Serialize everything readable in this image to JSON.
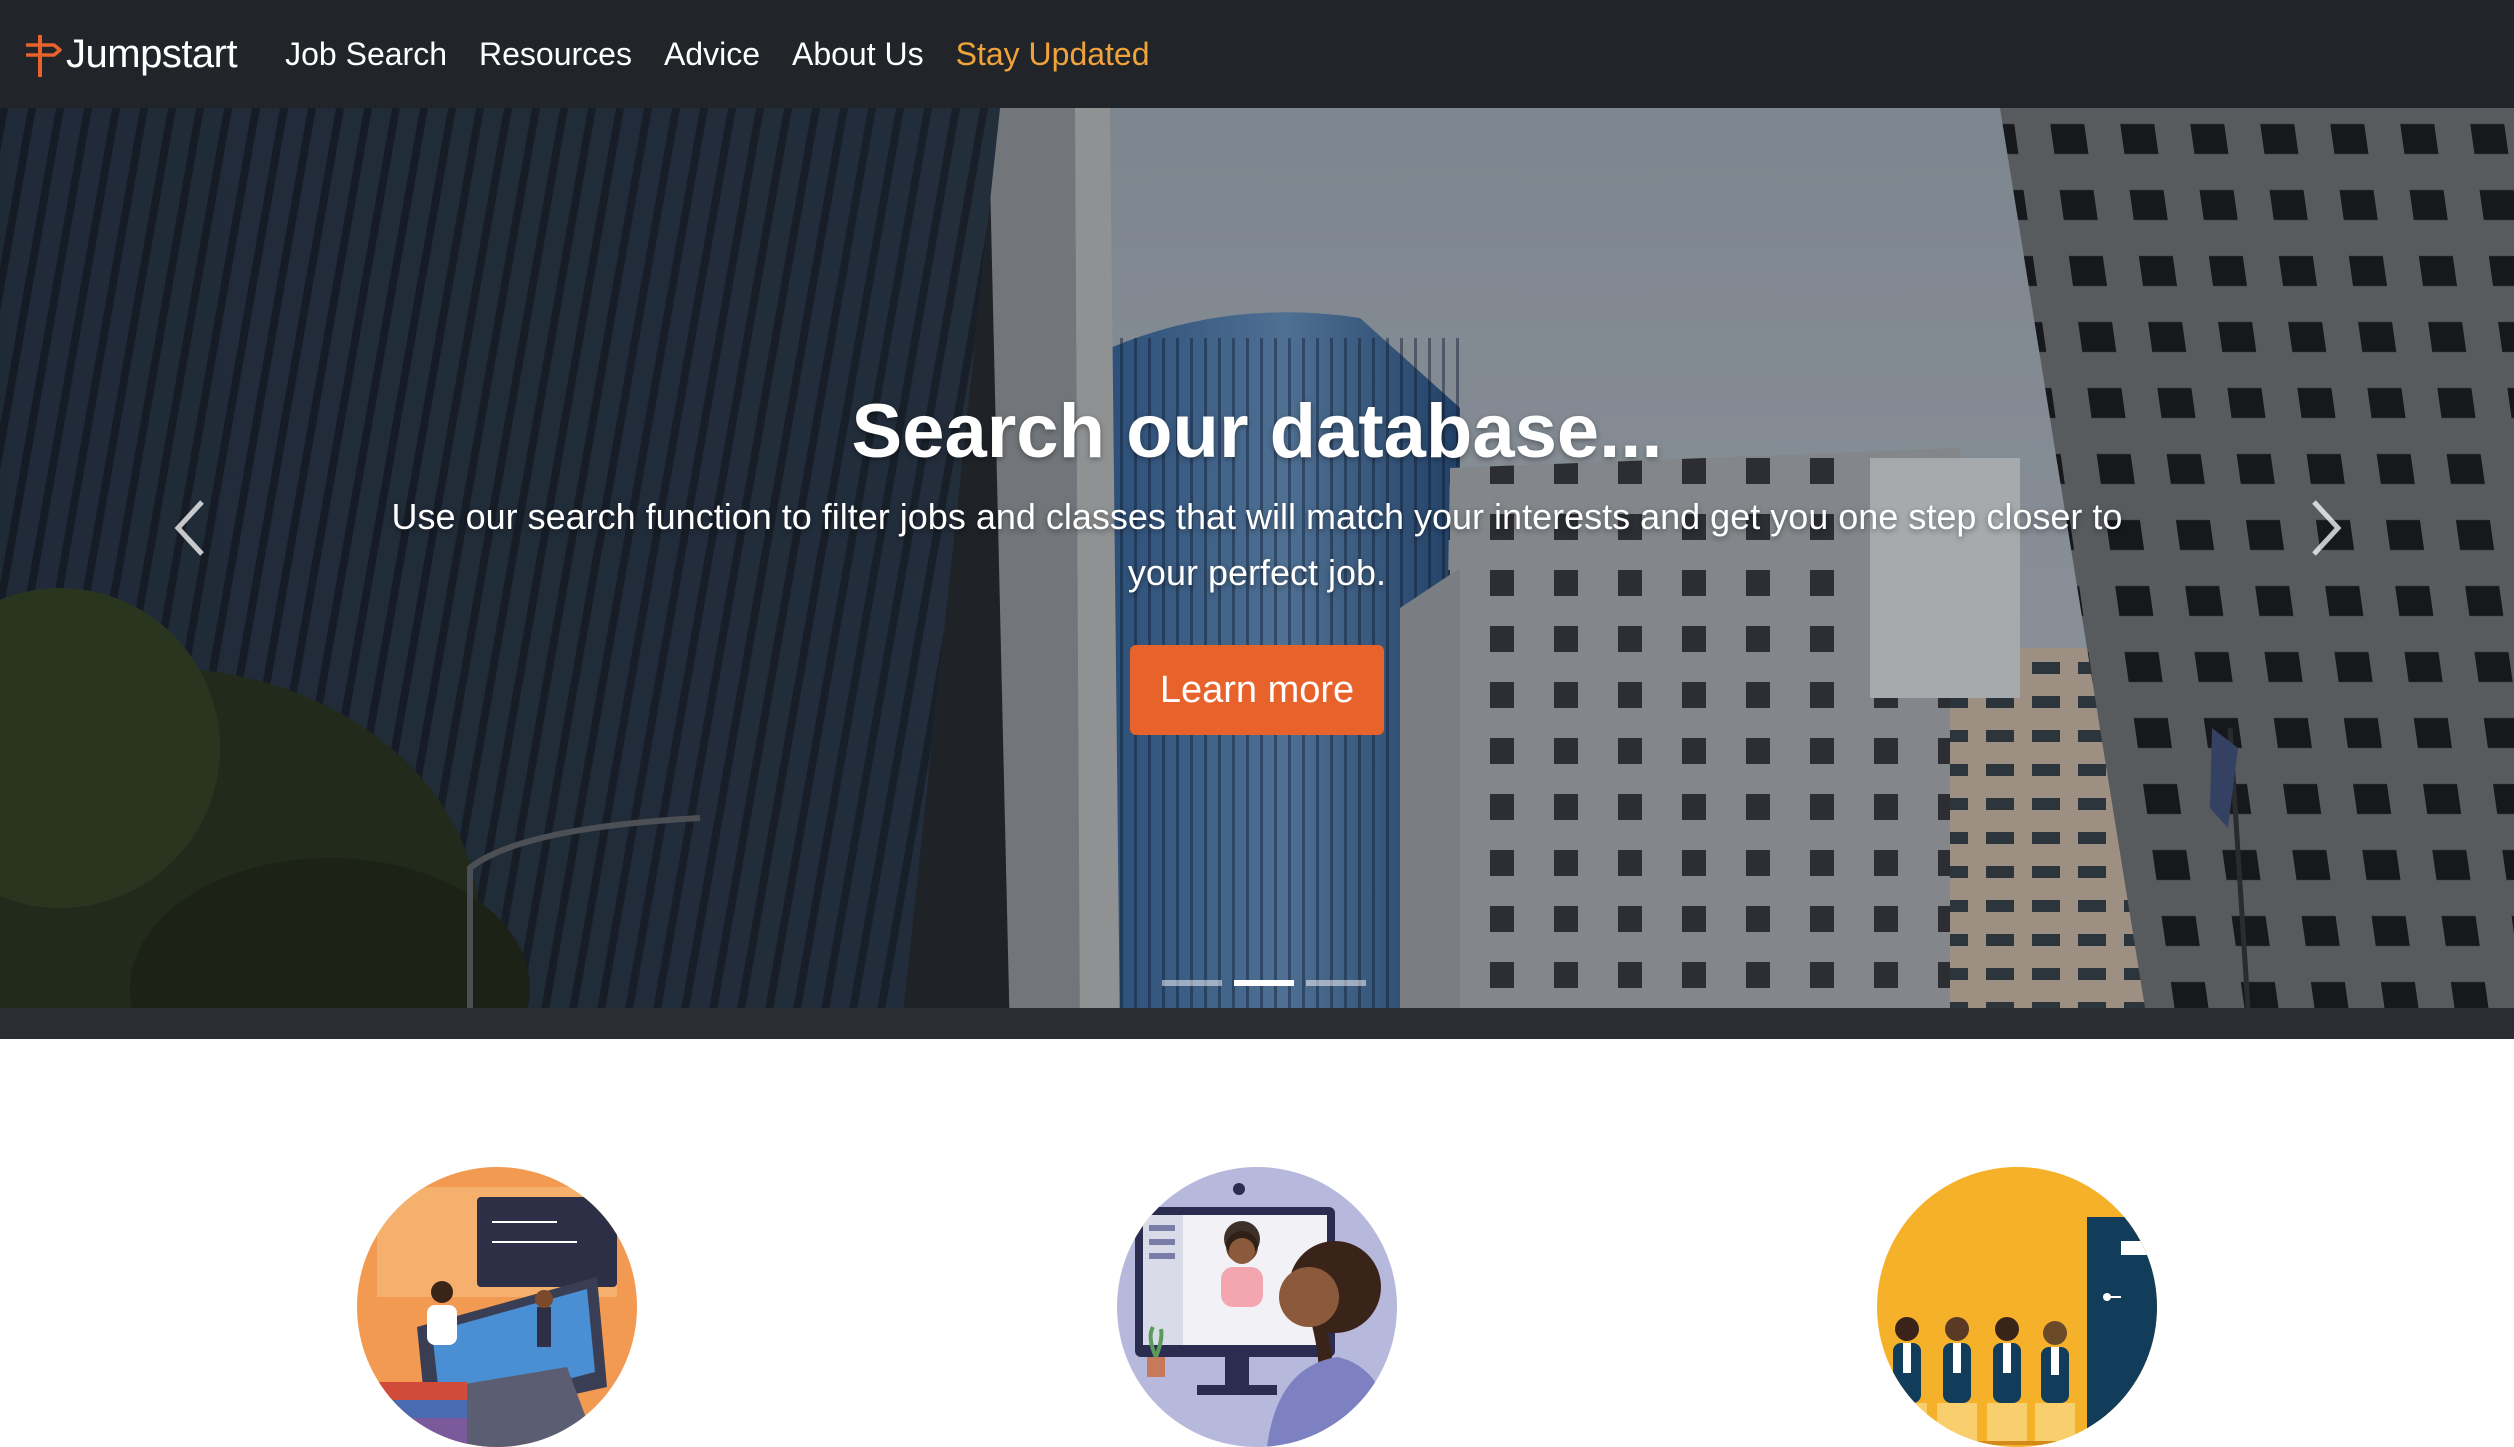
{
  "brand": {
    "name": "Jumpstart"
  },
  "nav": {
    "items": [
      {
        "label": "Job Search"
      },
      {
        "label": "Resources"
      },
      {
        "label": "Advice"
      },
      {
        "label": "About Us"
      },
      {
        "label": "Stay Updated"
      }
    ]
  },
  "hero": {
    "title": "Search our database...",
    "text": "Use our search function to filter jobs and classes that will match your interests and get you one step closer to your perfect job.",
    "button_label": "Learn more",
    "active_slide": 2,
    "slide_count": 3
  },
  "colors": {
    "navbar_bg": "#212529",
    "accent_orange": "#e8622c",
    "nav_highlight": "#f0a33a"
  },
  "icons": {
    "brand": "signpost-icon",
    "prev": "chevron-left-icon",
    "next": "chevron-right-icon"
  }
}
